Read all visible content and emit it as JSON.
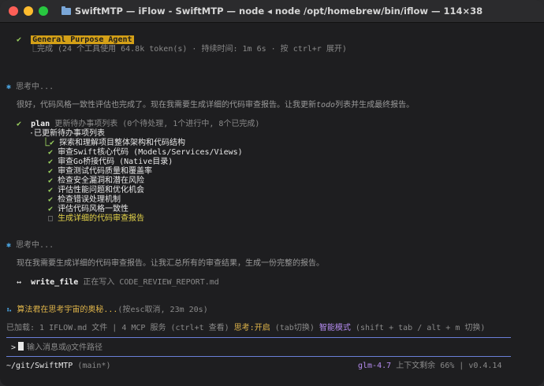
{
  "window": {
    "title": "SwiftMTP — iFlow - SwiftMTP — node ◂ node /opt/homebrew/bin/iflow — 114×38"
  },
  "agent_block": {
    "check": "✔",
    "name": "General Purpose Agent",
    "summary": "⎿完成 (24 个工具使用 64.8k token(s) · 持续时间: 1m 6s · 按 ctrl+r 展开)"
  },
  "thinking1": {
    "star": "✱",
    "label": "思考中...",
    "text_a": "很好，代码风格一致性评估也完成了。现在我需要生成详细的代码审查报告。让我更新",
    "text_italic": "todo",
    "text_b": "列表并生成最终报告。"
  },
  "plan": {
    "check": "✔",
    "name": "plan",
    "desc": "更新待办事项列表 (0个待处理, 1个进行中, 8个已完成)",
    "updated": "·已更新待办事项列表",
    "items": [
      {
        "mark": "⎿✔",
        "text": "探索和理解项目整体架构和代码结构"
      },
      {
        "mark": "✔",
        "text": "审查Swift核心代码 (Models/Services/Views)"
      },
      {
        "mark": "✔",
        "text": "审查Go桥接代码 (Native目录)"
      },
      {
        "mark": "✔",
        "text": "审查测试代码质量和覆盖率"
      },
      {
        "mark": "✔",
        "text": "检查安全漏洞和潜在风险"
      },
      {
        "mark": "✔",
        "text": "评估性能问题和优化机会"
      },
      {
        "mark": "✔",
        "text": "检查错误处理机制"
      },
      {
        "mark": "✔",
        "text": "评估代码风格一致性"
      },
      {
        "mark": "□",
        "text": "生成详细的代码审查报告"
      }
    ]
  },
  "thinking2": {
    "star": "✱",
    "label": "思考中...",
    "text": "现在我需要生成详细的代码审查报告。让我汇总所有的审查结果，生成一份完整的报告。"
  },
  "write": {
    "arrow": "↔",
    "name": "write_file",
    "desc": "正在写入 CODE_REVIEW_REPORT.md"
  },
  "status": {
    "spinner": "⠦",
    "text": "算法君在思考宇宙的奥秘...",
    "hint": "(按esc取消, 23m 20s)"
  },
  "info": {
    "loaded": "已加载: 1 IFLOW.md 文件 | 4 MCP 服务 (ctrl+t 查看)",
    "thinking": "思考:开启",
    "thinking_hint": "(tab切换)",
    "mode": "智能模式",
    "mode_hint": "(shift + tab / alt + m 切换)"
  },
  "input": {
    "prompt": ">",
    "placeholder": "输入消息或@文件路径"
  },
  "footer": {
    "path": "~/git/SwiftMTP",
    "branch": "(main*)",
    "model": "glm-4.7",
    "context": "上下文剩余 66% | v0.4.14"
  },
  "colors": {
    "accent_yellow": "#d4a017",
    "green": "#9cd35f",
    "blue": "#4aa3df",
    "purple": "#b58cf0",
    "separator": "#6a7fd8"
  }
}
